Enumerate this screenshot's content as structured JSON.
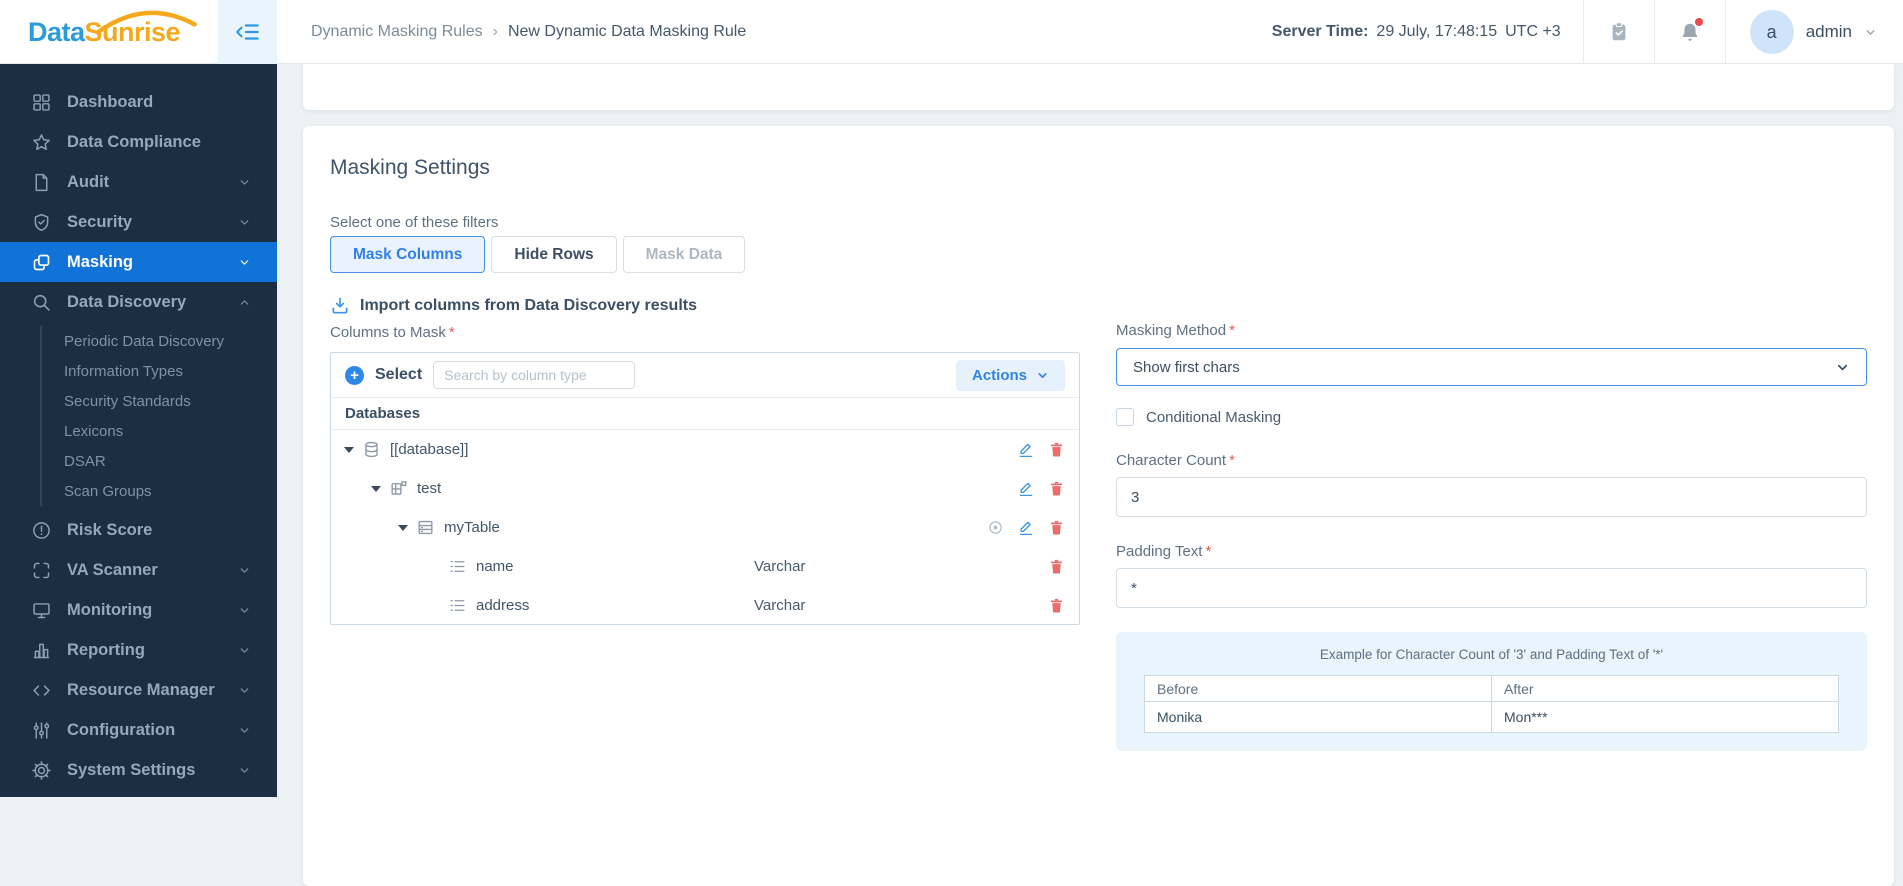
{
  "colors": {
    "brand_blue": "#2b9cdb",
    "brand_orange": "#f6a81c",
    "accent_blue": "#2f80ed",
    "sidebar_bg": "#1c2e42",
    "active_item_blue": "#1173d8",
    "danger_red": "#ed6b6b",
    "notification_red": "#e94b4b"
  },
  "header": {
    "logo_part1": "Data",
    "logo_part2": "Sunrise",
    "breadcrumb_section": "Dynamic Masking Rules",
    "breadcrumb_separator": "›",
    "breadcrumb_current": "New Dynamic Data Masking Rule",
    "server_time_label": "Server Time:",
    "server_time_value": "29 July, 17:48:15",
    "server_timezone": "UTC +3",
    "avatar_initial": "a",
    "username": "admin"
  },
  "sidebar": {
    "items": [
      {
        "label": "Dashboard"
      },
      {
        "label": "Data Compliance"
      },
      {
        "label": "Audit"
      },
      {
        "label": "Security"
      },
      {
        "label": "Masking"
      },
      {
        "label": "Data Discovery"
      },
      {
        "label": "Risk Score"
      },
      {
        "label": "VA Scanner"
      },
      {
        "label": "Monitoring"
      },
      {
        "label": "Reporting"
      },
      {
        "label": "Resource Manager"
      },
      {
        "label": "Configuration"
      },
      {
        "label": "System Settings"
      }
    ],
    "data_discovery_subitems": [
      {
        "label": "Periodic Data Discovery"
      },
      {
        "label": "Information Types"
      },
      {
        "label": "Security Standards"
      },
      {
        "label": "Lexicons"
      },
      {
        "label": "DSAR"
      },
      {
        "label": "Scan Groups"
      }
    ]
  },
  "main": {
    "title": "Masking Settings",
    "filters_label": "Select one of these filters",
    "filter_buttons": [
      {
        "label": "Mask Columns",
        "state": "active"
      },
      {
        "label": "Hide Rows",
        "state": "default"
      },
      {
        "label": "Mask Data",
        "state": "disabled"
      }
    ],
    "import_link_label": "Import columns from Data Discovery results",
    "required_mark": "*",
    "columns_to_mask": {
      "label": "Columns to Mask",
      "select_button_label": "Select",
      "search_placeholder": "Search by column type",
      "actions_button_label": "Actions",
      "group_header": "Databases",
      "tree": [
        {
          "name": "[[database]]",
          "type": ""
        },
        {
          "name": "test",
          "type": ""
        },
        {
          "name": "myTable",
          "type": ""
        },
        {
          "name": "name",
          "type": "Varchar"
        },
        {
          "name": "address",
          "type": "Varchar"
        }
      ]
    },
    "masking_method_label": "Masking Method",
    "masking_method_value": "Show first chars",
    "conditional_masking_label": "Conditional Masking",
    "character_count_label": "Character Count",
    "character_count_value": "3",
    "padding_text_label": "Padding Text",
    "padding_text_value": "*",
    "example": {
      "title": "Example for Character Count of '3' and Padding Text of '*'",
      "col_before": "Before",
      "col_after": "After",
      "row_before": "Monika",
      "row_after": "Mon***"
    }
  }
}
